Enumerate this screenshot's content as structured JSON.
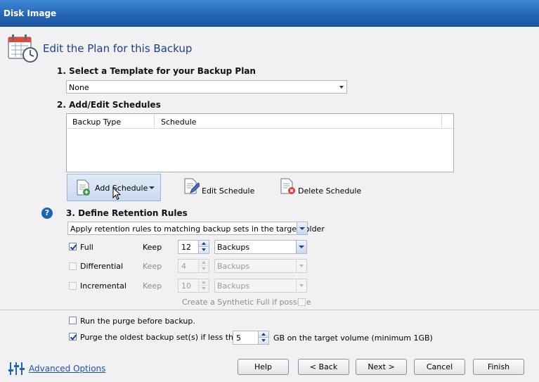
{
  "window": {
    "title": "Disk Image"
  },
  "header": {
    "title": "Edit the Plan for this Backup",
    "icon": "calendar-clock-icon"
  },
  "section1": {
    "title": "1. Select a Template for your Backup Plan",
    "template_value": "None"
  },
  "section2": {
    "title": "2. Add/Edit Schedules",
    "columns": [
      "Backup Type",
      "Schedule"
    ],
    "buttons": {
      "add": "Add Schedule",
      "edit": "Edit Schedule",
      "delete": "Delete Schedule"
    }
  },
  "section3": {
    "title": "3. Define Retention Rules",
    "rule_value": "Apply retention rules to matching backup sets in the target folder",
    "rows": [
      {
        "label": "Full",
        "checked": true,
        "keep_label": "Keep",
        "count": "12",
        "unit": "Backups",
        "enabled": true
      },
      {
        "label": "Differential",
        "checked": false,
        "keep_label": "Keep",
        "count": "4",
        "unit": "Backups",
        "enabled": false
      },
      {
        "label": "Incremental",
        "checked": false,
        "keep_label": "Keep",
        "count": "10",
        "unit": "Backups",
        "enabled": false
      }
    ],
    "synthetic_label": "Create a Synthetic Full if possible"
  },
  "options": {
    "run_purge_label": "Run the purge before backup.",
    "purge_oldest_label": "Purge the oldest backup set(s) if less than",
    "purge_gb_value": "5",
    "purge_gb_suffix": "GB on the target volume (minimum 1GB)"
  },
  "footer": {
    "advanced_label": "Advanced Options",
    "help": "Help",
    "back": "< Back",
    "next": "Next >",
    "cancel": "Cancel",
    "finish": "Finish"
  },
  "colors": {
    "titlebar": "#2364b3",
    "accent": "#1f3f86",
    "link": "#1f4fb3"
  }
}
